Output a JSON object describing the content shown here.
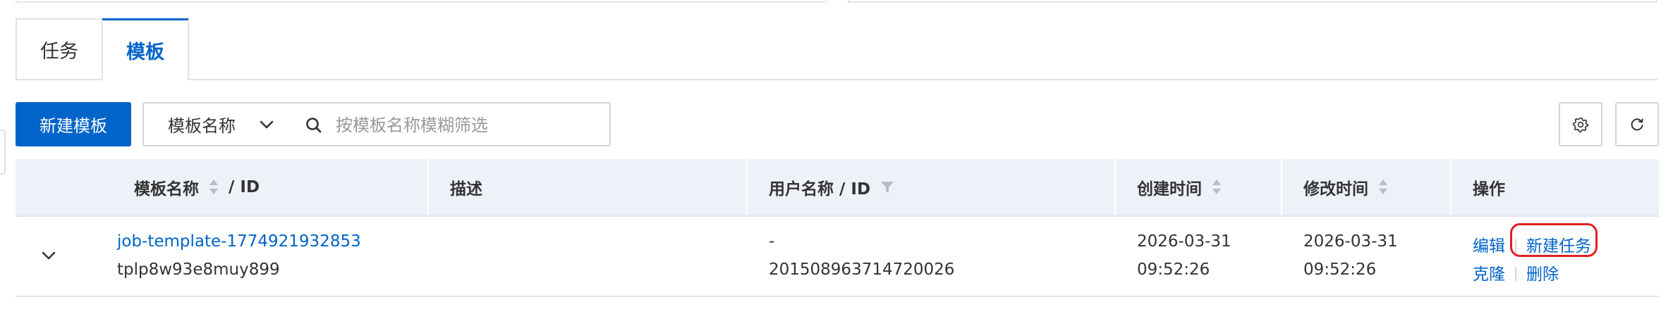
{
  "tabs": [
    {
      "label": "任务",
      "active": false
    },
    {
      "label": "模板",
      "active": true
    }
  ],
  "toolbar": {
    "new_template_label": "新建模板",
    "filter_select_value": "模板名称",
    "search_placeholder": "按模板名称模糊筛选",
    "search_value": ""
  },
  "icons": {
    "chevron": "chevron-down-icon",
    "search": "search-icon",
    "settings": "gear-icon",
    "refresh": "refresh-icon",
    "expand": "chevron-down-icon",
    "filter": "filter-icon"
  },
  "colors": {
    "accent": "#0064c8",
    "header_bg": "#edf1f8",
    "highlight": "#e02020"
  },
  "table": {
    "columns": {
      "name_id_a": "模板名称",
      "name_id_b": "/ ID",
      "desc": "描述",
      "user": "用户名称 / ID",
      "created": "创建时间",
      "modified": "修改时间",
      "ops": "操作"
    },
    "rows": [
      {
        "name": "job-template-1774921932853",
        "id": "tplp8w93e8muy899",
        "desc": "",
        "user_name": "-",
        "user_id": "2015089637147200​26",
        "created_date": "2026-03-31",
        "created_time": "09:52:26",
        "modified_date": "2026-03-31",
        "modified_time": "09:52:26",
        "ops": {
          "edit": "编辑",
          "new_task": "新建任务",
          "clone": "克隆",
          "delete": "删除"
        }
      }
    ]
  }
}
